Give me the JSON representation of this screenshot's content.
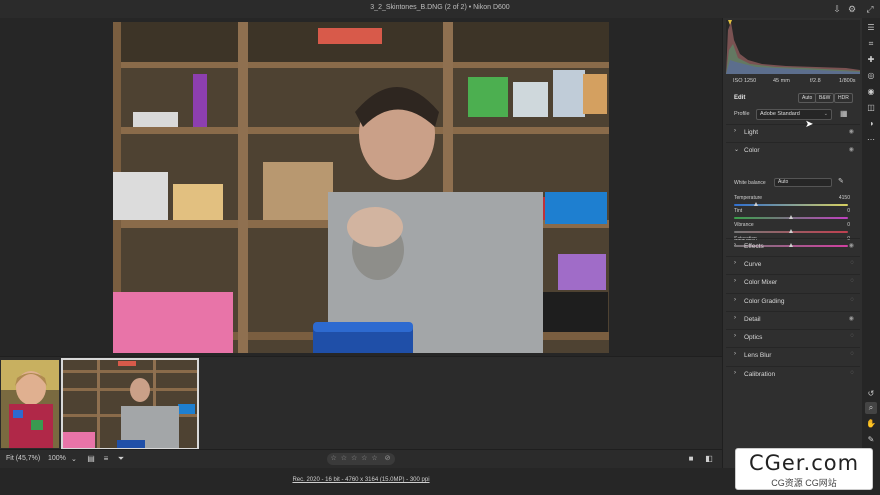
{
  "window": {
    "title": "3_2_Skintones_B.DNG (2 of 2) • Nikon D600",
    "icons": [
      "save-icon",
      "settings-icon",
      "expand-icon"
    ]
  },
  "exif": {
    "iso": "ISO 1250",
    "focal": "45 mm",
    "aperture": "f/2.8",
    "shutter": "1/800s"
  },
  "edit": {
    "label": "Edit",
    "auto": "Auto",
    "bw": "B&W",
    "hdr": "HDR"
  },
  "profile": {
    "label": "Profile",
    "value": "Adobe Standard"
  },
  "color": {
    "label": "Color",
    "white_balance_label": "White balance",
    "white_balance_value": "Auto",
    "sliders": [
      {
        "label": "Temperature",
        "value": "4150",
        "fraction": 0.2
      },
      {
        "label": "Tint",
        "value": "0",
        "fraction": 0.5
      },
      {
        "label": "Vibrance",
        "value": "0",
        "fraction": 0.5
      },
      {
        "label": "Saturation",
        "value": "0",
        "fraction": 0.5
      }
    ]
  },
  "sections": {
    "light": "Light",
    "effects": "Effects",
    "curve": "Curve",
    "color_mixer": "Color Mixer",
    "color_grading": "Color Grading",
    "detail": "Detail",
    "optics": "Optics",
    "lens_blur": "Lens Blur",
    "calibration": "Calibration"
  },
  "statusbar": {
    "fit": "Fit (45,7%)",
    "zoom": "100%",
    "stars": "☆ ☆ ☆ ☆ ☆",
    "rating_clear": "⊘"
  },
  "bottom": {
    "image_info": "Rec. 2020 - 16 bit - 4760 x 3164 (15.0MP) - 300 ppi"
  },
  "watermark": {
    "big": "CGer.com",
    "small": "CG资源  CG网站"
  }
}
